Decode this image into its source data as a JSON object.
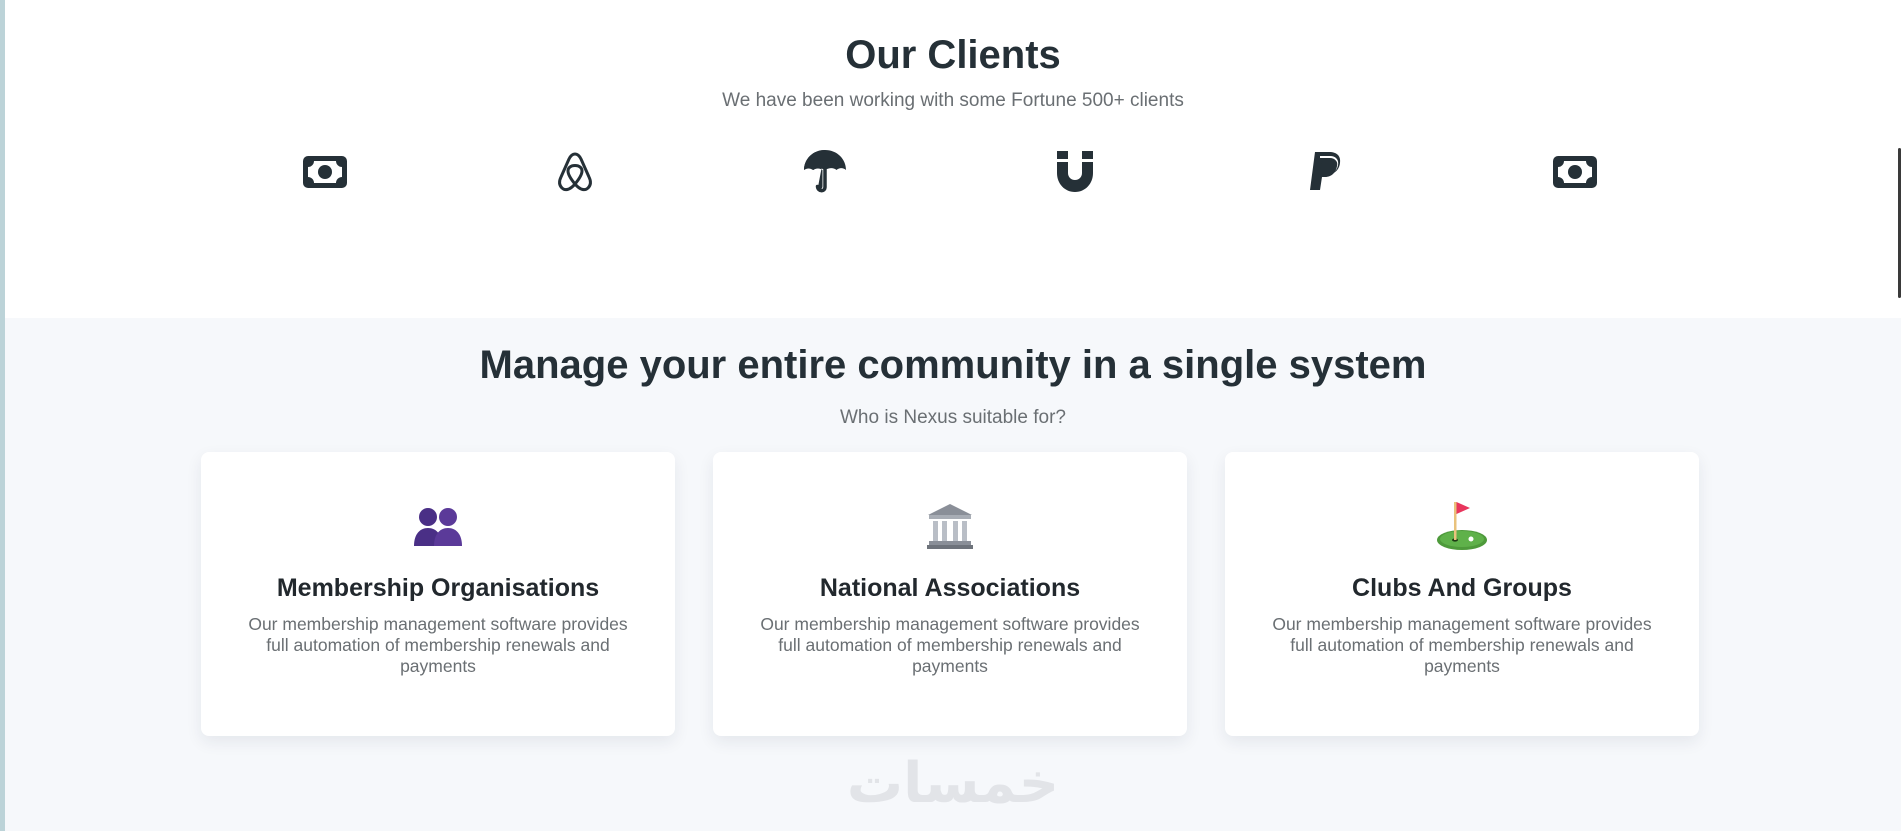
{
  "clients": {
    "title": "Our Clients",
    "subtitle": "We have been working with some Fortune 500+ clients",
    "logos": [
      {
        "icon": "money-bill-icon"
      },
      {
        "icon": "airbnb-icon"
      },
      {
        "icon": "umbrella-icon"
      },
      {
        "icon": "magnet-icon"
      },
      {
        "icon": "paypal-icon"
      },
      {
        "icon": "money-bill-icon"
      }
    ]
  },
  "community": {
    "title": "Manage your entire community in a single system",
    "subtitle": "Who is Nexus suitable for?",
    "cards": [
      {
        "icon": "people-silhouette-icon",
        "title": "Membership Organisations",
        "text": "Our membership management software provides full automation of membership renewals and payments"
      },
      {
        "icon": "classical-building-icon",
        "title": "National Associations",
        "text": "Our membership management software provides full automation of membership renewals and payments"
      },
      {
        "icon": "golf-flag-icon",
        "title": "Clubs And Groups",
        "text": "Our membership management software provides full automation of membership renewals and payments"
      }
    ]
  },
  "watermark": "خمسات",
  "colors": {
    "heading": "#253037",
    "muted": "#6a6f73",
    "section_bg": "#f6f8fb",
    "icon_dark": "#253037",
    "people_purple": "#5b3a99",
    "paypal_dark": "#253037"
  }
}
